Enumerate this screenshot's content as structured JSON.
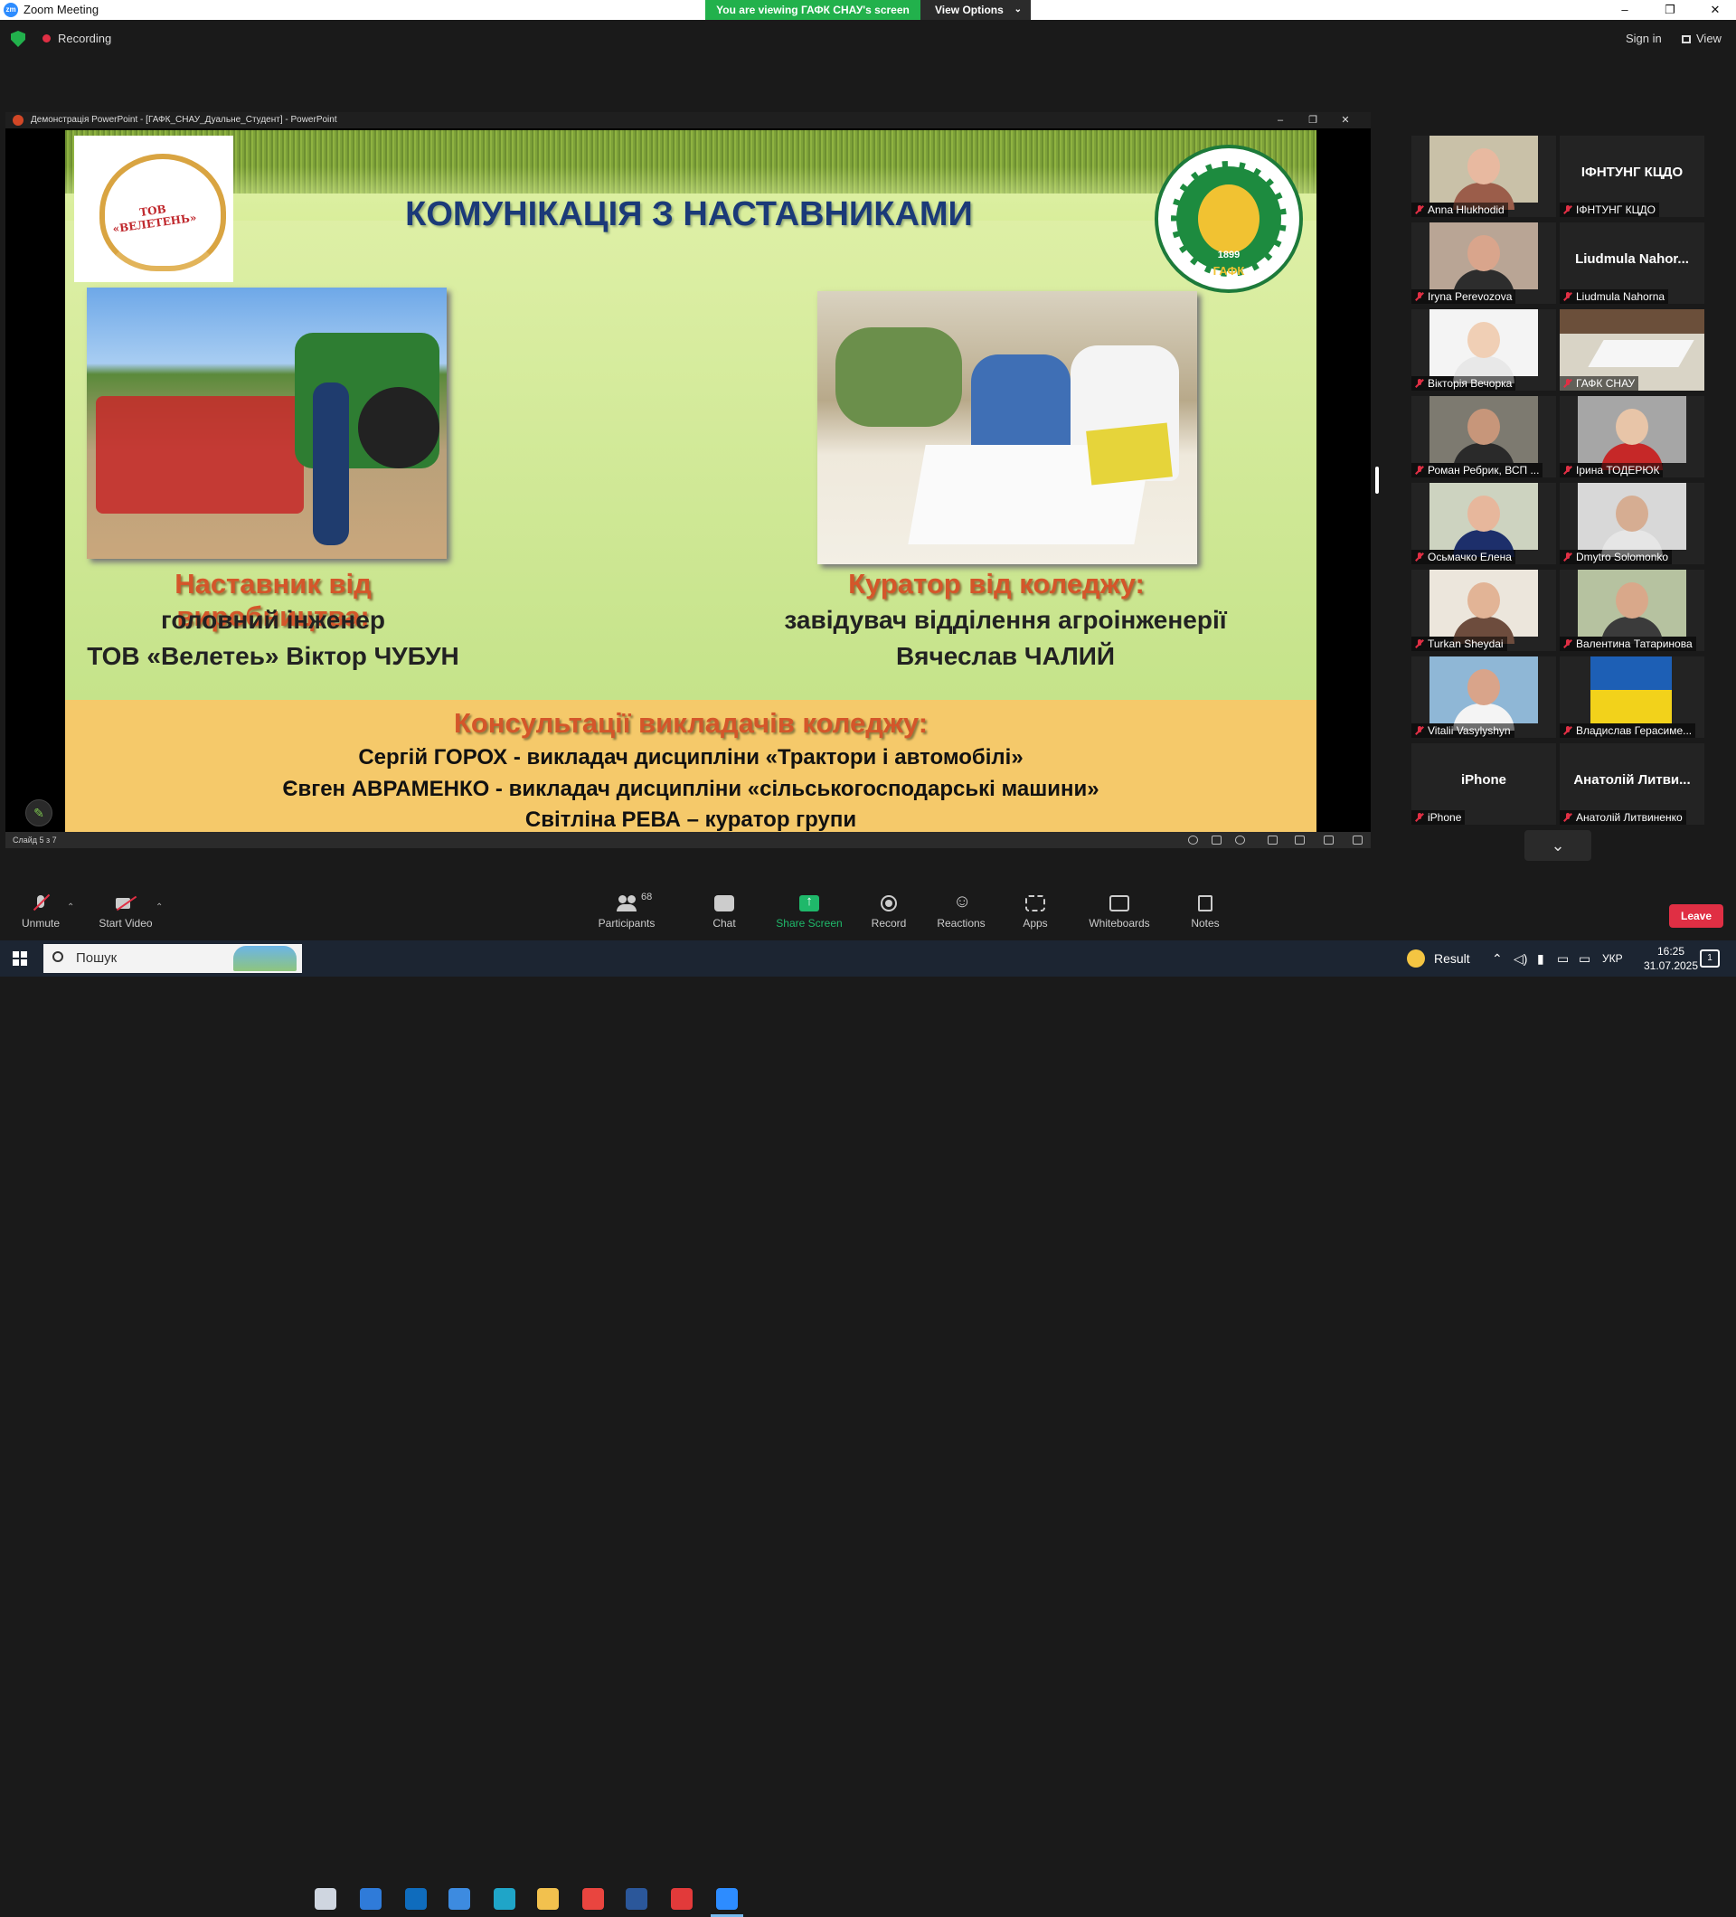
{
  "window": {
    "app_title": "Zoom Meeting",
    "banner": "You are viewing ГАФК СНАУ's screen",
    "view_options": "View Options",
    "minimize": "–",
    "maximize": "❐",
    "close": "✕"
  },
  "status": {
    "recording": "Recording",
    "sign_in": "Sign in",
    "view": "View"
  },
  "ppt": {
    "title": "Демонстрація PowerPoint - [ГАФК_СНАУ_Дуальне_Студент] - PowerPoint",
    "slide_counter": "Слайд 5 з 7"
  },
  "slide": {
    "title": "КОМУНІКАЦІЯ З НАСТАВНИКАМИ",
    "logo_left_text": "ТОВ «ВЕЛЕТЕНЬ»",
    "logo_right_year": "1899",
    "logo_right_abbr": "ГАФК",
    "mentor_heading": "Наставник від виробництва:",
    "mentor_line1": "головний інженер",
    "mentor_line2": "ТОВ «Велетеь» Віктор ЧУБУН",
    "curator_heading": "Куратор від коледжу:",
    "curator_line1": "завідувач відділення агроінженерії",
    "curator_line2": "Вячеслав ЧАЛИЙ",
    "consult_heading": "Консультації викладачів коледжу:",
    "consult_line1": "Сергій ГОРОХ  - викладач дисципліни «Трактори і автомобілі»",
    "consult_line2": "Євген АВРАМЕНКО  -  викладач  дисципліни «сільськогосподарські машини»",
    "consult_line3": "Світліна РЕВА – куратор групи"
  },
  "gallery": [
    {
      "name": "Anna Hlukhodid",
      "type": "video",
      "skin": "#e8b9a0",
      "shirt": "#9b5d4a",
      "bg": "#c9c1a8"
    },
    {
      "name": "ІФНТУНГ КЦДО",
      "big": "ІФНТУНГ КЦДО",
      "type": "text"
    },
    {
      "name": "Iryna Perevozova",
      "type": "video",
      "skin": "#d9a58c",
      "shirt": "#2d2d2d",
      "bg": "#b9a595"
    },
    {
      "name": "Liudmula Nahorna",
      "big": "Liudmula  Nahor...",
      "type": "text"
    },
    {
      "name": "Вікторія Вечорка",
      "type": "video",
      "skin": "#f0cfb5",
      "shirt": "#e8e8e8",
      "bg": "#f4f4f4"
    },
    {
      "name": "ГАФК СНАУ",
      "type": "room",
      "active": true
    },
    {
      "name": "Роман Ребрик, ВСП ...",
      "type": "video",
      "skin": "#c7967a",
      "shirt": "#2a2a2a",
      "bg": "#7d7a70"
    },
    {
      "name": "Ірина ТОДЕРЮК",
      "type": "video",
      "skin": "#e8c5a8",
      "shirt": "#c62828",
      "bg": "#a6a6a6"
    },
    {
      "name": "Осьмачко Елена",
      "type": "video",
      "skin": "#e7b79c",
      "shirt": "#1d2f6b",
      "bg": "#cdd3c0"
    },
    {
      "name": "Dmytro Solomonko",
      "type": "video",
      "skin": "#d6ad92",
      "shirt": "#e6e6e6",
      "bg": "#d8d8d8"
    },
    {
      "name": "Turkan Sheydai",
      "type": "video",
      "skin": "#e2b496",
      "shirt": "#6d4c3d",
      "bg": "#ece6dc"
    },
    {
      "name": "Валентина Татаринова",
      "type": "video",
      "skin": "#d9a88a",
      "shirt": "#3b3b3b",
      "bg": "#b6c2a0"
    },
    {
      "name": "Vitalii Vasylyshyn",
      "type": "video",
      "skin": "#d9a48a",
      "shirt": "#f4f4f4",
      "bg": "#8fb7d6"
    },
    {
      "name": "Владислав Герасиме...",
      "type": "flag"
    },
    {
      "name": "iPhone",
      "big": "iPhone",
      "type": "text"
    },
    {
      "name": "Анатолій Литвиненко",
      "big": "Анатолій  Литви...",
      "type": "text"
    }
  ],
  "toolbar": {
    "unmute": "Unmute",
    "start_video": "Start Video",
    "participants": "Participants",
    "participants_count": "68",
    "chat": "Chat",
    "share_screen": "Share Screen",
    "record": "Record",
    "reactions": "Reactions",
    "apps": "Apps",
    "whiteboards": "Whiteboards",
    "notes": "Notes",
    "leave": "Leave"
  },
  "taskbar": {
    "search_placeholder": "Пошук",
    "weather": "Result",
    "language": "УКР",
    "time": "16:25",
    "date": "31.07.2025",
    "notifications": "1",
    "apps": [
      {
        "name": "task-view",
        "color": "#cfd6e0"
      },
      {
        "name": "copilot",
        "color": "#2f7bd9"
      },
      {
        "name": "outlook",
        "color": "#0f6cbd"
      },
      {
        "name": "store",
        "color": "#3d8be0"
      },
      {
        "name": "edge",
        "color": "#1fa5c8"
      },
      {
        "name": "explorer",
        "color": "#f2c14e"
      },
      {
        "name": "chrome",
        "color": "#e9453f"
      },
      {
        "name": "word",
        "color": "#2b579a"
      },
      {
        "name": "wps",
        "color": "#e23a3a"
      },
      {
        "name": "zoom",
        "color": "#2d8cff",
        "active": true
      }
    ]
  }
}
